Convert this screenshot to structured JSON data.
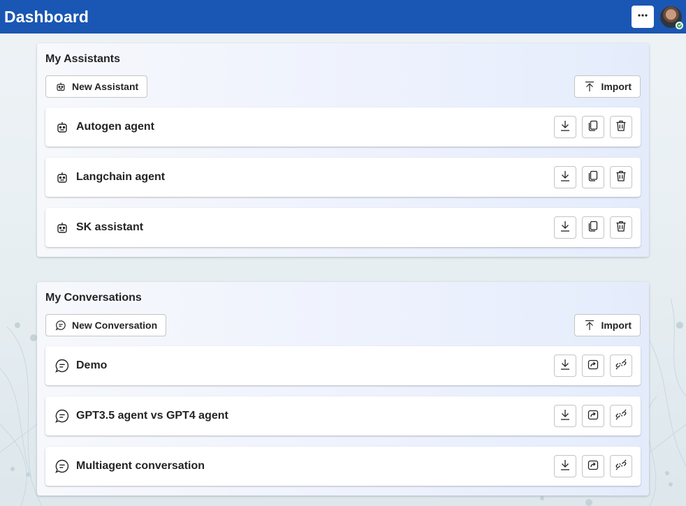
{
  "header": {
    "title": "Dashboard",
    "more_icon": "more-horizontal-icon",
    "avatar_status": "available"
  },
  "assistants": {
    "title": "My Assistants",
    "new_label": "New Assistant",
    "new_icon": "bot-icon",
    "import_label": "Import",
    "import_icon": "upload-icon",
    "items": [
      {
        "label": "Autogen agent",
        "icon": "bot-icon",
        "actions": [
          "download-icon",
          "copy-icon",
          "delete-icon"
        ]
      },
      {
        "label": "Langchain agent",
        "icon": "bot-icon",
        "actions": [
          "download-icon",
          "copy-icon",
          "delete-icon"
        ]
      },
      {
        "label": "SK assistant",
        "icon": "bot-icon",
        "actions": [
          "download-icon",
          "copy-icon",
          "delete-icon"
        ]
      }
    ]
  },
  "conversations": {
    "title": "My Conversations",
    "new_label": "New Conversation",
    "new_icon": "chat-icon",
    "import_label": "Import",
    "import_icon": "upload-icon",
    "items": [
      {
        "label": "Demo",
        "icon": "chat-icon",
        "actions": [
          "download-icon",
          "share-icon",
          "plug-disconnected-icon"
        ]
      },
      {
        "label": "GPT3.5 agent vs GPT4 agent",
        "icon": "chat-icon",
        "actions": [
          "download-icon",
          "share-icon",
          "plug-disconnected-icon"
        ]
      },
      {
        "label": "Multiagent conversation",
        "icon": "chat-icon",
        "actions": [
          "download-icon",
          "share-icon",
          "plug-disconnected-icon"
        ]
      }
    ]
  },
  "colors": {
    "header_bg": "#1a56b3",
    "header_text": "#ffffff",
    "text": "#242424",
    "border": "#c4c4c4",
    "presence": "#2ea44f"
  }
}
